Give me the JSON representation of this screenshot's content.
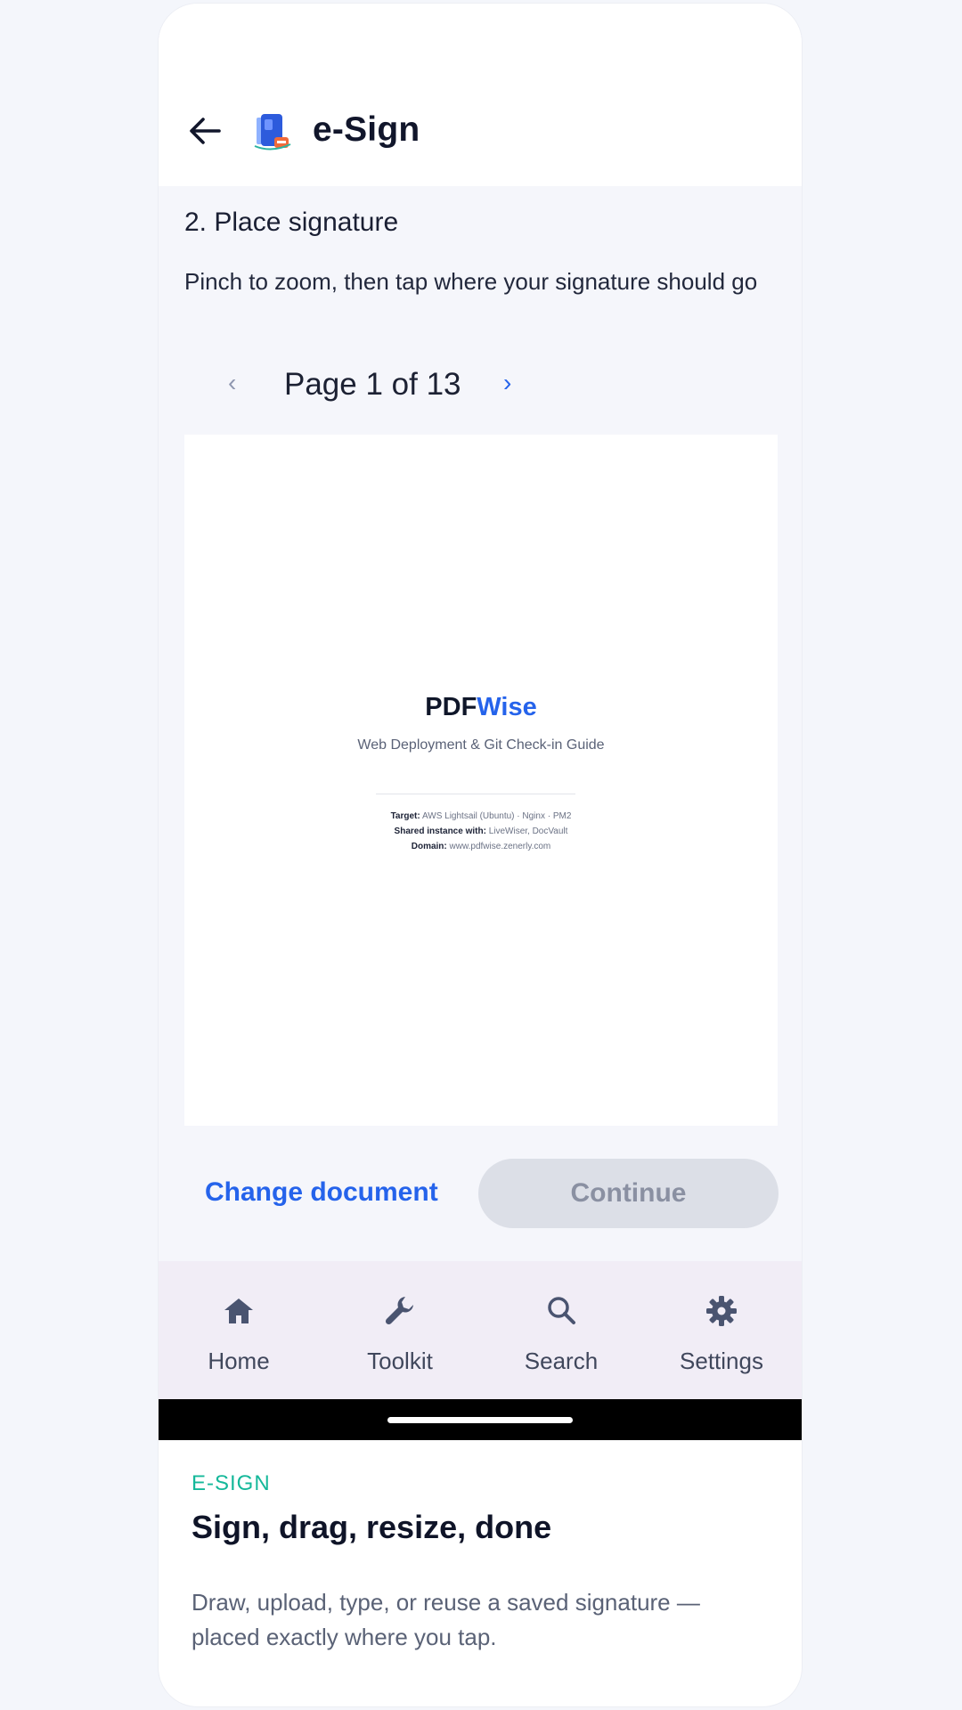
{
  "app_bar": {
    "title": "e-Sign"
  },
  "step": {
    "title": "2. Place signature",
    "instructions": "Pinch to zoom, then tap where your signature should go"
  },
  "pager": {
    "prev": "‹",
    "label": "Page 1 of 13",
    "next": "›"
  },
  "document": {
    "brand_part1": "PDF",
    "brand_part2": "Wise",
    "subtitle": "Web Deployment & Git Check-in Guide",
    "meta": [
      {
        "key": "Target:",
        "value": "AWS Lightsail (Ubuntu) · Nginx · PM2"
      },
      {
        "key": "Shared instance with:",
        "value": "LiveWiser, DocVault"
      },
      {
        "key": "Domain:",
        "value": "www.pdfwise.zenerly.com"
      }
    ]
  },
  "actions": {
    "change_document": "Change document",
    "continue": "Continue"
  },
  "bottom_nav": [
    {
      "label": "Home",
      "icon": "home-icon"
    },
    {
      "label": "Toolkit",
      "icon": "wrench-icon"
    },
    {
      "label": "Search",
      "icon": "search-icon"
    },
    {
      "label": "Settings",
      "icon": "gear-icon"
    }
  ],
  "promo": {
    "eyebrow": "E-SIGN",
    "headline": "Sign, drag, resize, done",
    "description": "Draw, upload, type, or reuse a saved signature — placed exactly where you tap."
  },
  "colors": {
    "accent": "#2563eb",
    "teal": "#15b89a",
    "nav_bg": "#f1edf6",
    "disabled_bg": "#dcdfe7"
  }
}
